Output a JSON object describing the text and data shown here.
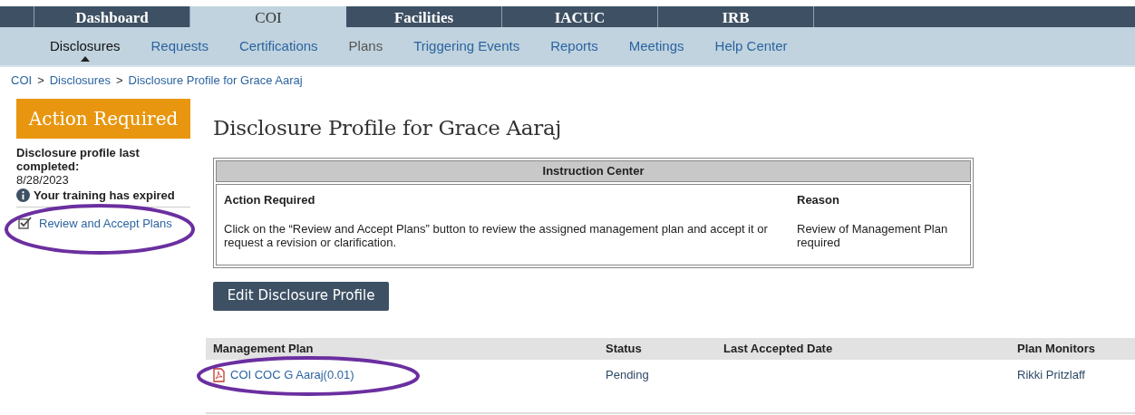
{
  "main_tabs": [
    {
      "label": "Dashboard",
      "selected": false
    },
    {
      "label": "COI",
      "selected": true
    },
    {
      "label": "Facilities",
      "selected": false
    },
    {
      "label": "IACUC",
      "selected": false
    },
    {
      "label": "IRB",
      "selected": false
    }
  ],
  "sub_tabs": [
    {
      "label": "Disclosures",
      "selected": true,
      "link": false
    },
    {
      "label": "Requests",
      "selected": false,
      "link": true
    },
    {
      "label": "Certifications",
      "selected": false,
      "link": true
    },
    {
      "label": "Plans",
      "selected": false,
      "link": false
    },
    {
      "label": "Triggering Events",
      "selected": false,
      "link": true
    },
    {
      "label": "Reports",
      "selected": false,
      "link": true
    },
    {
      "label": "Meetings",
      "selected": false,
      "link": true
    },
    {
      "label": "Help Center",
      "selected": false,
      "link": true
    }
  ],
  "breadcrumb_separator": ">",
  "breadcrumb": [
    "COI",
    "Disclosures",
    "Disclosure Profile for Grace Aaraj"
  ],
  "sidebar": {
    "status_badge": "Action Required",
    "profile_label": "Disclosure profile last completed:",
    "profile_date": "8/28/2023",
    "alert": "Your training has expired",
    "action_link": "Review and Accept Plans"
  },
  "page_title": "Disclosure Profile for Grace Aaraj",
  "instruction_center": {
    "title": "Instruction Center",
    "columns": [
      "Action Required",
      "Reason"
    ],
    "action": "Click on the “Review and Accept Plans” button to review the assigned management plan and accept it or request a revision or clarification.",
    "reason": "Review of Management Plan required"
  },
  "edit_button": "Edit Disclosure Profile",
  "plans_table": {
    "columns": [
      "Management Plan",
      "Status",
      "Last Accepted Date",
      "Plan Monitors"
    ],
    "rows": [
      {
        "plan": "COI COC G Aaraj(0.01)",
        "status": "Pending",
        "monitors": "Rikki Pritzlaff"
      }
    ]
  }
}
